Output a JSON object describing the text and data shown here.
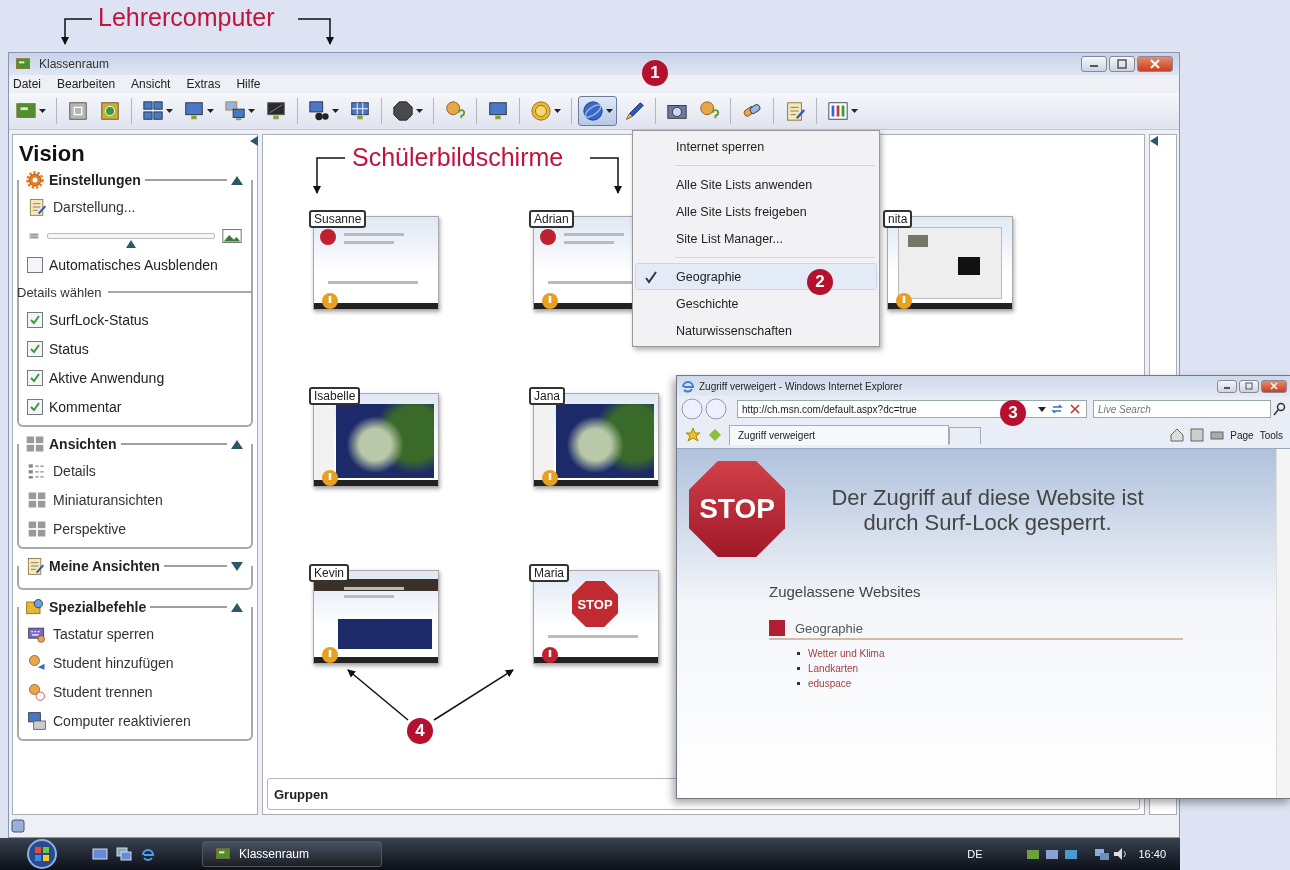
{
  "annotations": {
    "title": "Lehrercomputer",
    "thumbs_label": "Schülerbildschirme",
    "callouts": [
      "1",
      "2",
      "3",
      "4"
    ]
  },
  "window": {
    "title": "Klassenraum"
  },
  "menu": [
    "Datei",
    "Bearbeiten",
    "Ansicht",
    "Extras",
    "Hilfe"
  ],
  "toolbar": [
    [
      {
        "kind": "board",
        "dropdown": true,
        "selected": false
      }
    ],
    [
      {
        "kind": "frame",
        "dropdown": false,
        "selected": false
      },
      {
        "kind": "power",
        "dropdown": false,
        "selected": false
      }
    ],
    [
      {
        "kind": "grid",
        "dropdown": true,
        "selected": false
      },
      {
        "kind": "monitor",
        "dropdown": true,
        "selected": false
      },
      {
        "kind": "monitors",
        "dropdown": true,
        "selected": false
      },
      {
        "kind": "monitor-dark",
        "dropdown": false,
        "selected": false
      }
    ],
    [
      {
        "kind": "binoculars",
        "dropdown": true,
        "selected": false
      },
      {
        "kind": "monitor-grid",
        "dropdown": false,
        "selected": false
      }
    ],
    [
      {
        "kind": "stop",
        "dropdown": true,
        "selected": false
      }
    ],
    [
      {
        "kind": "person",
        "dropdown": false,
        "selected": false
      }
    ],
    [
      {
        "kind": "monitor",
        "dropdown": false,
        "selected": false
      }
    ],
    [
      {
        "kind": "coin",
        "dropdown": true,
        "selected": false
      }
    ],
    [
      {
        "kind": "globe",
        "dropdown": true,
        "selected": true
      },
      {
        "kind": "pen",
        "dropdown": false,
        "selected": false
      }
    ],
    [
      {
        "kind": "camera",
        "dropdown": false,
        "selected": false
      },
      {
        "kind": "person",
        "dropdown": false,
        "selected": false
      }
    ],
    [
      {
        "kind": "link",
        "dropdown": false,
        "selected": false
      }
    ],
    [
      {
        "kind": "note",
        "dropdown": false,
        "selected": false
      }
    ],
    [
      {
        "kind": "columns",
        "dropdown": true,
        "selected": false
      }
    ]
  ],
  "sidebar": {
    "title": "Vision",
    "panels": [
      {
        "title": "Einstellungen",
        "expanded": true,
        "items": [
          {
            "kind": "link",
            "label": "Darstellung..."
          },
          {
            "kind": "slider",
            "level": 0.5
          },
          {
            "kind": "checkbox",
            "label": "Automatisches Ausblenden",
            "checked": false
          },
          {
            "kind": "group",
            "label": "Details wählen"
          },
          {
            "kind": "checkbox",
            "label": "SurfLock-Status",
            "checked": true
          },
          {
            "kind": "checkbox",
            "label": "Status",
            "checked": true
          },
          {
            "kind": "checkbox",
            "label": "Aktive Anwendung",
            "checked": true
          },
          {
            "kind": "checkbox",
            "label": "Kommentar",
            "checked": true
          }
        ]
      },
      {
        "title": "Ansichten",
        "expanded": true,
        "items": [
          {
            "kind": "link",
            "label": "Details"
          },
          {
            "kind": "link",
            "label": "Miniaturansichten"
          },
          {
            "kind": "link",
            "label": "Perspektive"
          }
        ]
      },
      {
        "title": "Meine Ansichten",
        "expanded": false
      },
      {
        "title": "Spezialbefehle",
        "expanded": true,
        "items": [
          {
            "kind": "link",
            "label": "Tastatur sperren"
          },
          {
            "kind": "link",
            "label": "Student hinzufügen"
          },
          {
            "kind": "link",
            "label": "Student trennen"
          },
          {
            "kind": "link",
            "label": "Computer reaktivieren"
          }
        ]
      }
    ]
  },
  "thumbnails": [
    {
      "name": "Susanne",
      "kind": "stop-page",
      "color": "#e8a020"
    },
    {
      "name": "Adrian",
      "kind": "stop-page",
      "color": "#e8a020"
    },
    {
      "name": "nita",
      "kind": "photo-page",
      "color": "#e8a020"
    },
    {
      "name": "Isabelle",
      "kind": "map",
      "color": "#e8a020"
    },
    {
      "name": "Jana",
      "kind": "map",
      "color": "#e8a020"
    },
    {
      "name": "Kevin",
      "kind": "news",
      "color": "#e8a020"
    },
    {
      "name": "Maria",
      "kind": "stop-sign",
      "sign": "STOP",
      "color": "#c02030"
    }
  ],
  "groups_panel": {
    "title": "Gruppen"
  },
  "dropdown": {
    "sections": [
      [
        {
          "label": "Internet sperren",
          "checked": false,
          "selected": false
        }
      ],
      [
        {
          "label": "Alle Site Lists anwenden",
          "checked": false,
          "selected": false
        },
        {
          "label": "Alle Site Lists freigeben",
          "checked": false,
          "selected": false
        },
        {
          "label": "Site List Manager...",
          "checked": false,
          "selected": false
        }
      ],
      [
        {
          "label": "Geographie",
          "checked": true,
          "selected": true
        },
        {
          "label": "Geschichte",
          "checked": false,
          "selected": false
        },
        {
          "label": "Naturwissenschaften",
          "checked": false,
          "selected": false
        }
      ]
    ]
  },
  "browser": {
    "title": "Zugriff verweigert - Windows Internet Explorer",
    "address": "http://ch.msn.com/default.aspx?dc=true",
    "search": {
      "placeholder": "Live Search"
    },
    "tab": "Zugriff verweigert",
    "commands": [
      "Page",
      "Tools"
    ],
    "page": {
      "stop_sign": "STOP",
      "heading": "Der Zugriff auf diese Website ist durch Surf-Lock gesperrt.",
      "subheading": "Zugelassene Websites",
      "category": "Geographie",
      "links": [
        "Wetter und Klima",
        "Landkarten",
        "eduspace"
      ]
    }
  },
  "taskbar": {
    "task": "Klassenraum",
    "language": "DE",
    "clock": "16:40"
  }
}
